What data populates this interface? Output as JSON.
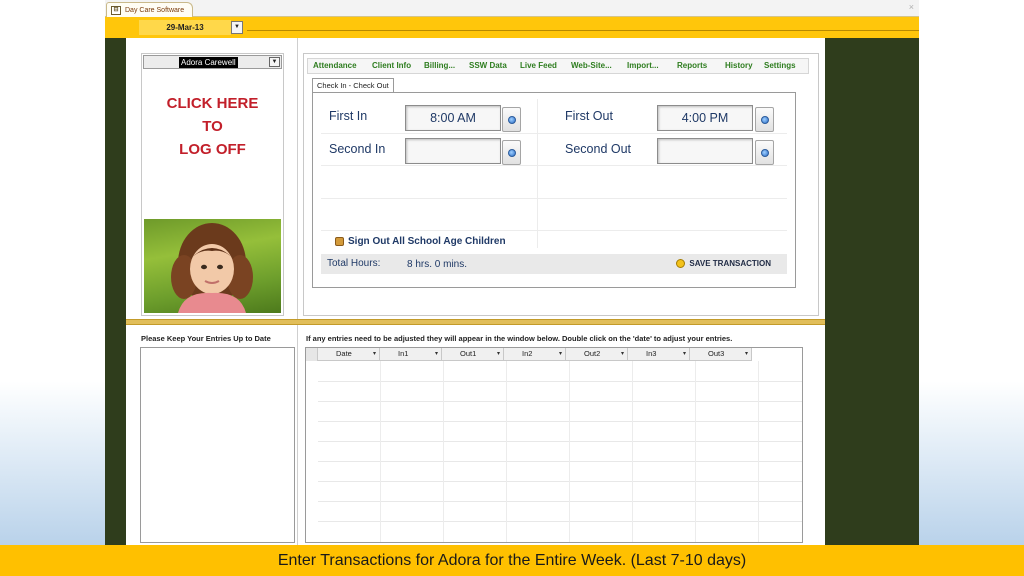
{
  "window": {
    "tab_label": "Day Care Software",
    "close_label": "×"
  },
  "header": {
    "date_value": "29-Mar-13",
    "dropdown_glyph": "▼"
  },
  "child": {
    "selected_name": "Adora Carewell",
    "dropdown_glyph": "▼"
  },
  "logoff": {
    "line1": "CLICK HERE",
    "line2": "TO",
    "line3": "LOG OFF"
  },
  "nav": {
    "tabs": [
      "Attendance",
      "Client Info",
      "Billing...",
      "SSW Data",
      "Live Feed",
      "Web-Site...",
      "Import...",
      "Reports",
      "History",
      "Settings"
    ]
  },
  "subtab": {
    "label": "Check In - Check Out"
  },
  "checkin": {
    "first_in_label": "First In",
    "first_in_value": "8:00 AM",
    "first_out_label": "First Out",
    "first_out_value": "4:00 PM",
    "second_in_label": "Second In",
    "second_in_value": "",
    "second_out_label": "Second Out",
    "second_out_value": ""
  },
  "signout": {
    "label": "Sign Out All School Age Children"
  },
  "totals": {
    "label": "Total Hours:",
    "value": "8 hrs. 0 mins.",
    "save_label": "SAVE TRANSACTION"
  },
  "bottom": {
    "left_title": "Please Keep Your Entries Up to Date",
    "right_title": "If any entries need to be adjusted they will appear in the window below. Double click on the 'date' to adjust your entries.",
    "columns": [
      "Date",
      "In1",
      "Out1",
      "In2",
      "Out2",
      "In3",
      "Out3"
    ],
    "col_arrow": "▾"
  },
  "caption": {
    "text": "Enter Transactions for Adora for the Entire Week. (Last 7-10 days)"
  }
}
